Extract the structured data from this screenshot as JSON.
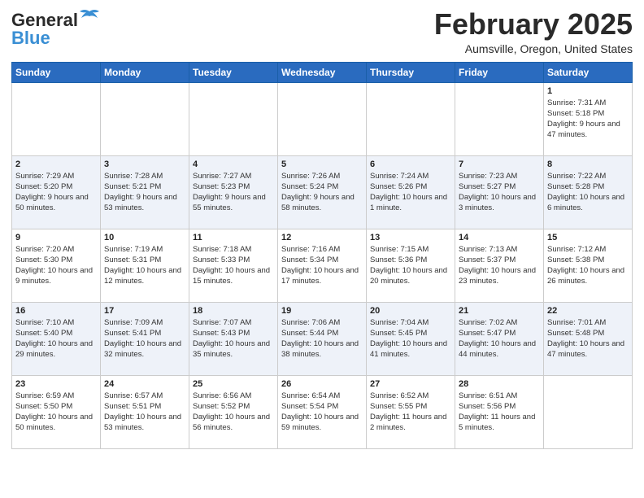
{
  "header": {
    "logo_line1": "General",
    "logo_line2": "Blue",
    "month": "February 2025",
    "location": "Aumsville, Oregon, United States"
  },
  "weekdays": [
    "Sunday",
    "Monday",
    "Tuesday",
    "Wednesday",
    "Thursday",
    "Friday",
    "Saturday"
  ],
  "weeks": [
    [
      {
        "day": "",
        "info": ""
      },
      {
        "day": "",
        "info": ""
      },
      {
        "day": "",
        "info": ""
      },
      {
        "day": "",
        "info": ""
      },
      {
        "day": "",
        "info": ""
      },
      {
        "day": "",
        "info": ""
      },
      {
        "day": "1",
        "info": "Sunrise: 7:31 AM\nSunset: 5:18 PM\nDaylight: 9 hours and 47 minutes."
      }
    ],
    [
      {
        "day": "2",
        "info": "Sunrise: 7:29 AM\nSunset: 5:20 PM\nDaylight: 9 hours and 50 minutes."
      },
      {
        "day": "3",
        "info": "Sunrise: 7:28 AM\nSunset: 5:21 PM\nDaylight: 9 hours and 53 minutes."
      },
      {
        "day": "4",
        "info": "Sunrise: 7:27 AM\nSunset: 5:23 PM\nDaylight: 9 hours and 55 minutes."
      },
      {
        "day": "5",
        "info": "Sunrise: 7:26 AM\nSunset: 5:24 PM\nDaylight: 9 hours and 58 minutes."
      },
      {
        "day": "6",
        "info": "Sunrise: 7:24 AM\nSunset: 5:26 PM\nDaylight: 10 hours and 1 minute."
      },
      {
        "day": "7",
        "info": "Sunrise: 7:23 AM\nSunset: 5:27 PM\nDaylight: 10 hours and 3 minutes."
      },
      {
        "day": "8",
        "info": "Sunrise: 7:22 AM\nSunset: 5:28 PM\nDaylight: 10 hours and 6 minutes."
      }
    ],
    [
      {
        "day": "9",
        "info": "Sunrise: 7:20 AM\nSunset: 5:30 PM\nDaylight: 10 hours and 9 minutes."
      },
      {
        "day": "10",
        "info": "Sunrise: 7:19 AM\nSunset: 5:31 PM\nDaylight: 10 hours and 12 minutes."
      },
      {
        "day": "11",
        "info": "Sunrise: 7:18 AM\nSunset: 5:33 PM\nDaylight: 10 hours and 15 minutes."
      },
      {
        "day": "12",
        "info": "Sunrise: 7:16 AM\nSunset: 5:34 PM\nDaylight: 10 hours and 17 minutes."
      },
      {
        "day": "13",
        "info": "Sunrise: 7:15 AM\nSunset: 5:36 PM\nDaylight: 10 hours and 20 minutes."
      },
      {
        "day": "14",
        "info": "Sunrise: 7:13 AM\nSunset: 5:37 PM\nDaylight: 10 hours and 23 minutes."
      },
      {
        "day": "15",
        "info": "Sunrise: 7:12 AM\nSunset: 5:38 PM\nDaylight: 10 hours and 26 minutes."
      }
    ],
    [
      {
        "day": "16",
        "info": "Sunrise: 7:10 AM\nSunset: 5:40 PM\nDaylight: 10 hours and 29 minutes."
      },
      {
        "day": "17",
        "info": "Sunrise: 7:09 AM\nSunset: 5:41 PM\nDaylight: 10 hours and 32 minutes."
      },
      {
        "day": "18",
        "info": "Sunrise: 7:07 AM\nSunset: 5:43 PM\nDaylight: 10 hours and 35 minutes."
      },
      {
        "day": "19",
        "info": "Sunrise: 7:06 AM\nSunset: 5:44 PM\nDaylight: 10 hours and 38 minutes."
      },
      {
        "day": "20",
        "info": "Sunrise: 7:04 AM\nSunset: 5:45 PM\nDaylight: 10 hours and 41 minutes."
      },
      {
        "day": "21",
        "info": "Sunrise: 7:02 AM\nSunset: 5:47 PM\nDaylight: 10 hours and 44 minutes."
      },
      {
        "day": "22",
        "info": "Sunrise: 7:01 AM\nSunset: 5:48 PM\nDaylight: 10 hours and 47 minutes."
      }
    ],
    [
      {
        "day": "23",
        "info": "Sunrise: 6:59 AM\nSunset: 5:50 PM\nDaylight: 10 hours and 50 minutes."
      },
      {
        "day": "24",
        "info": "Sunrise: 6:57 AM\nSunset: 5:51 PM\nDaylight: 10 hours and 53 minutes."
      },
      {
        "day": "25",
        "info": "Sunrise: 6:56 AM\nSunset: 5:52 PM\nDaylight: 10 hours and 56 minutes."
      },
      {
        "day": "26",
        "info": "Sunrise: 6:54 AM\nSunset: 5:54 PM\nDaylight: 10 hours and 59 minutes."
      },
      {
        "day": "27",
        "info": "Sunrise: 6:52 AM\nSunset: 5:55 PM\nDaylight: 11 hours and 2 minutes."
      },
      {
        "day": "28",
        "info": "Sunrise: 6:51 AM\nSunset: 5:56 PM\nDaylight: 11 hours and 5 minutes."
      },
      {
        "day": "",
        "info": ""
      }
    ]
  ]
}
